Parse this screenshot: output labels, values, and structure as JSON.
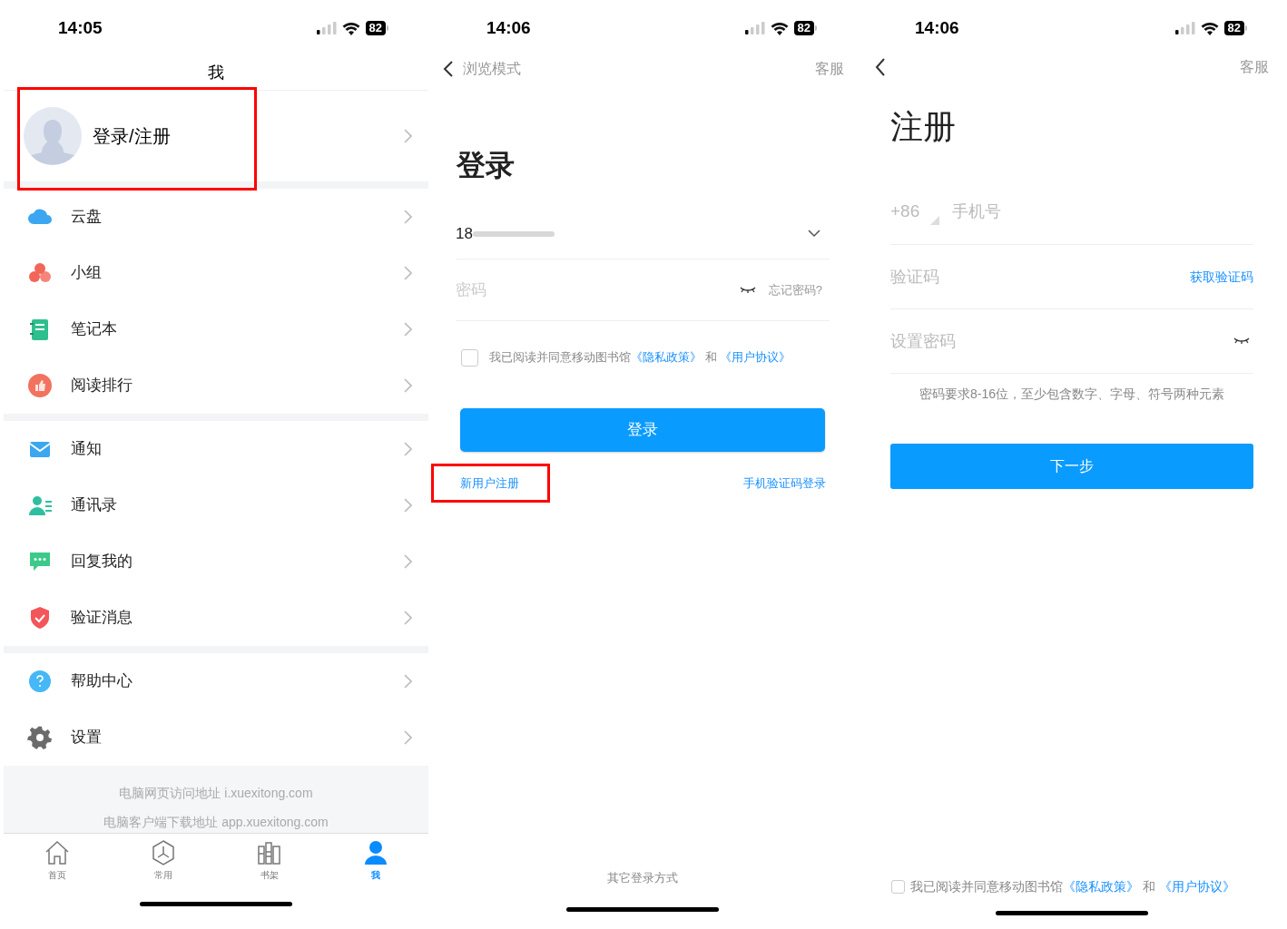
{
  "profile_screen": {
    "status_bar": {
      "time": "14:05",
      "battery": "82"
    },
    "title": "我",
    "profile": {
      "label": "登录/注册",
      "highlighted": true
    },
    "menu_groups": [
      [
        {
          "kind": "cloud",
          "label": "云盘",
          "color": "#3aa7f0"
        },
        {
          "kind": "group",
          "label": "小组",
          "color": "#f2665a"
        },
        {
          "kind": "notebook",
          "label": "笔记本",
          "color": "#2fbf8f"
        },
        {
          "kind": "ranking",
          "label": "阅读排行",
          "color": "#f2725f"
        }
      ],
      [
        {
          "kind": "mail",
          "label": "通知",
          "color": "#3aa7f0"
        },
        {
          "kind": "contacts",
          "label": "通讯录",
          "color": "#2fbfa0"
        },
        {
          "kind": "chat",
          "label": "回复我的",
          "color": "#3cc98a"
        },
        {
          "kind": "shield",
          "label": "验证消息",
          "color": "#f2565a"
        }
      ],
      [
        {
          "kind": "help",
          "label": "帮助中心",
          "color": "#45b8f5"
        },
        {
          "kind": "gear",
          "label": "设置",
          "color": "#6b6b6b"
        }
      ]
    ],
    "footer": [
      "电脑网页访问地址 i.xuexitong.com",
      "电脑客户端下载地址 app.xuexitong.com"
    ],
    "tab_bar": [
      {
        "kind": "home",
        "label": "首页",
        "selected": false
      },
      {
        "kind": "hexagon",
        "label": "常用",
        "selected": false
      },
      {
        "kind": "shelf",
        "label": "书架",
        "selected": false
      },
      {
        "kind": "person",
        "label": "我",
        "selected": true
      }
    ]
  },
  "login_screen": {
    "status_bar": {
      "time": "14:06",
      "battery": "82"
    },
    "back_label": "浏览模式",
    "service": "客服",
    "title": "登录",
    "account": {
      "value": "18"
    },
    "password": {
      "placeholder": "密码",
      "forgot": "忘记密码?"
    },
    "agreement": {
      "checked": false,
      "text": "我已阅读并同意移动图书馆",
      "privacy": "《隐私政策》",
      "and": "和",
      "terms": "《用户协议》"
    },
    "login_button": "登录",
    "register_link": {
      "label": "新用户注册",
      "highlighted": true
    },
    "sms_login_link": "手机验证码登录",
    "other_methods": "其它登录方式"
  },
  "register_screen": {
    "status_bar": {
      "time": "14:06",
      "battery": "82"
    },
    "service": "客服",
    "title": "注册",
    "country_code": "+86",
    "phone": {
      "placeholder": "手机号"
    },
    "code": {
      "placeholder": "验证码",
      "action": "获取验证码"
    },
    "password": {
      "placeholder": "设置密码"
    },
    "hint": "密码要求8-16位，至少包含数字、字母、符号两种元素",
    "next_button": "下一步",
    "agreement": {
      "checked": false,
      "text": "我已阅读并同意移动图书馆",
      "privacy": "《隐私政策》",
      "and": "和",
      "terms": "《用户协议》"
    }
  }
}
